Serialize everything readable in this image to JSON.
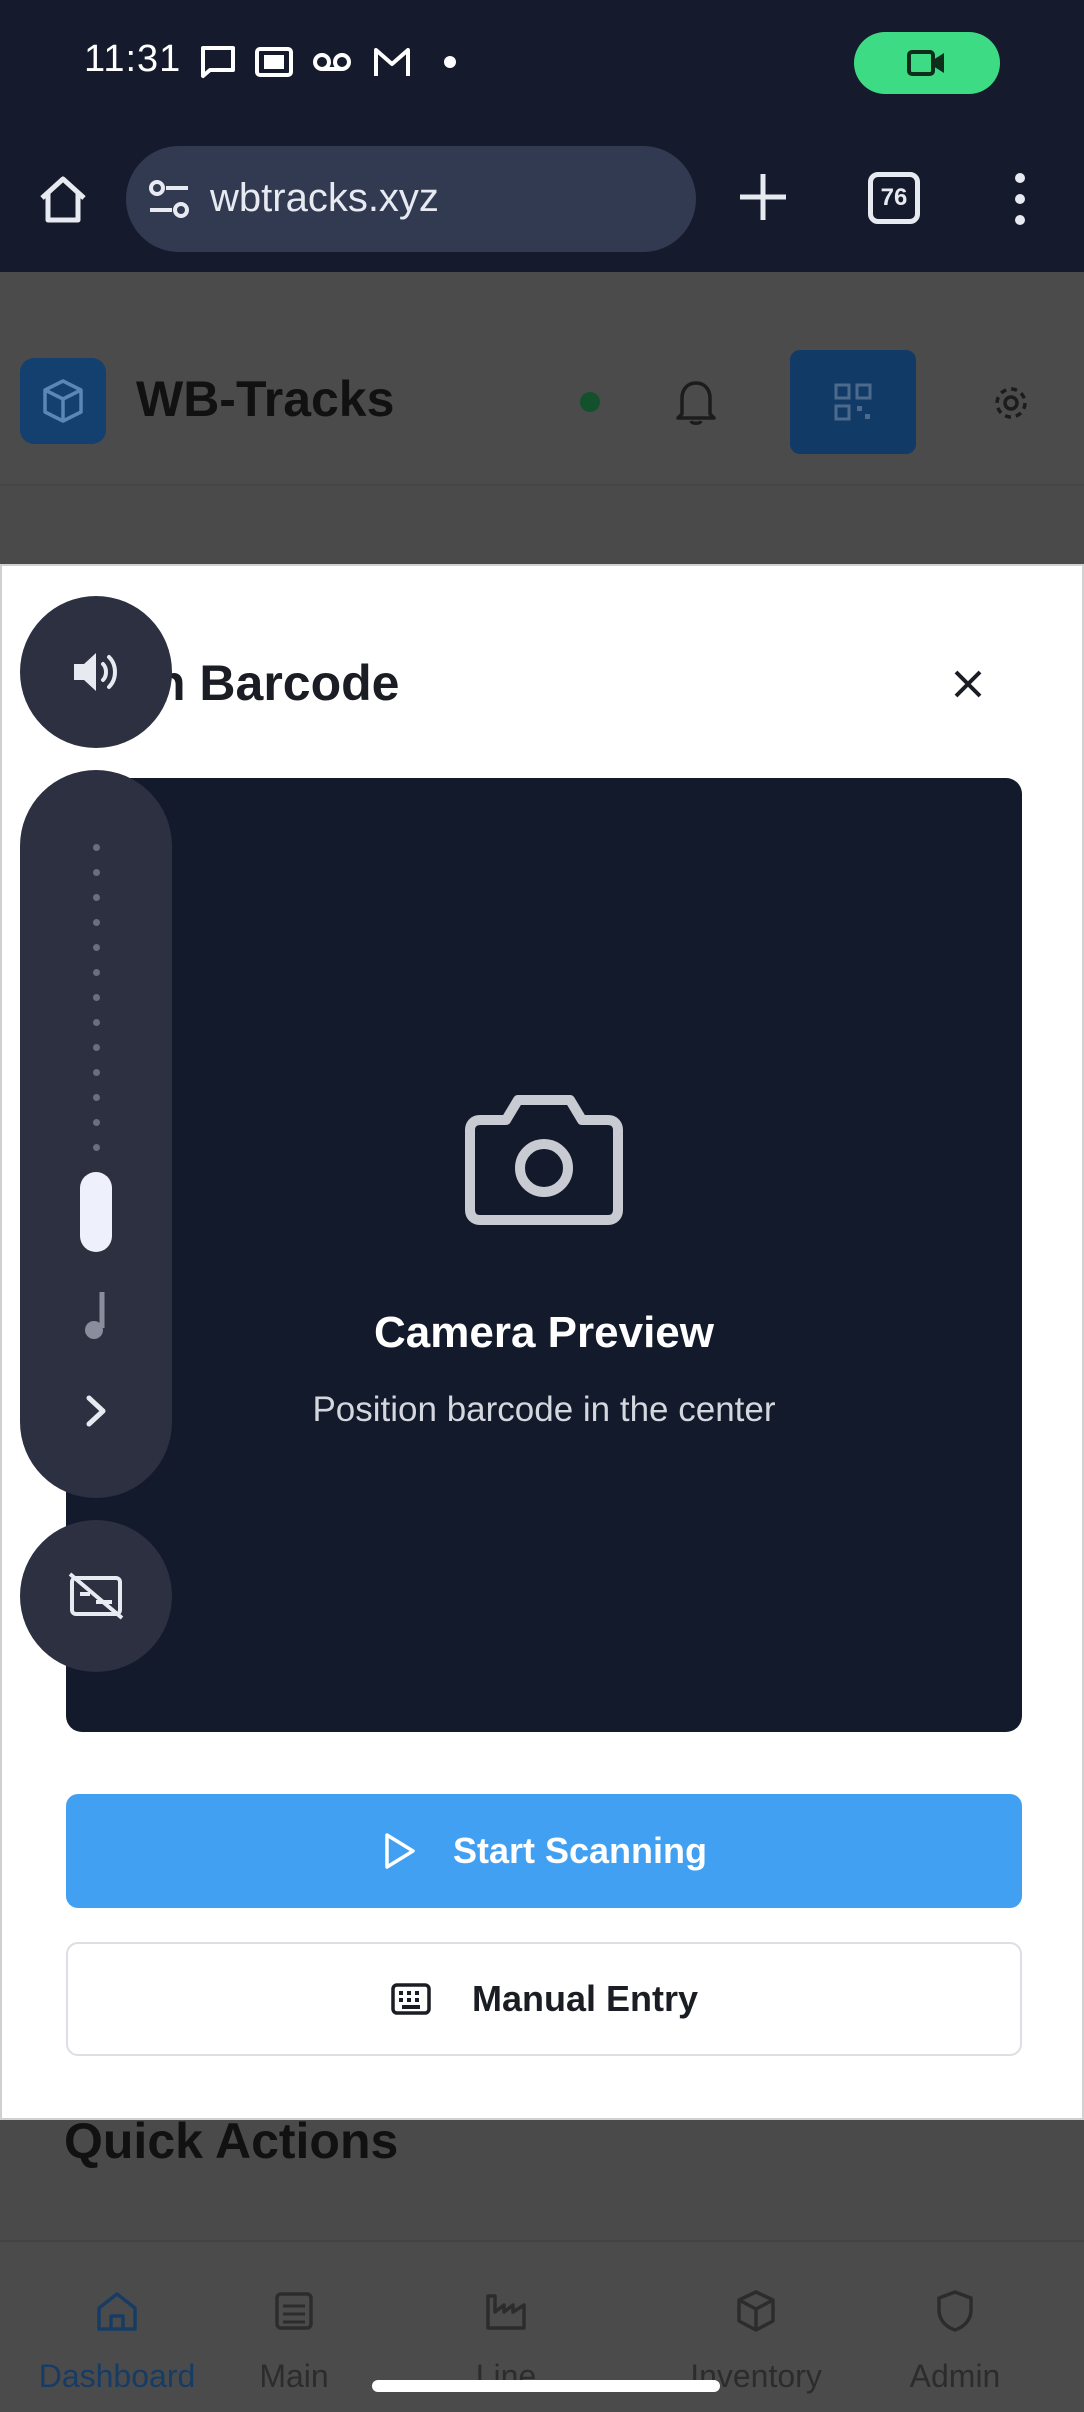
{
  "status_bar": {
    "time": "11:31",
    "icons": [
      "message-icon",
      "cast-icon",
      "voicemail-icon",
      "gmail-icon",
      "dot-icon"
    ],
    "recording_icon": "video-camera-icon",
    "recording_color": "#3ddc84"
  },
  "browser": {
    "url": "wbtracks.xyz",
    "tab_count": "76"
  },
  "app": {
    "title": "WB-Tracks",
    "online_color": "#1e8a4c",
    "accent": "#42a0f3"
  },
  "page": {
    "quick_actions_heading": "Quick Actions"
  },
  "modal": {
    "title": "Scan Barcode",
    "camera_title": "Camera Preview",
    "camera_subtitle": "Position barcode in the center",
    "start_label": "Start Scanning",
    "manual_label": "Manual Entry"
  },
  "volume_panel": {
    "icons": [
      "speaker-icon",
      "music-note-icon",
      "chevron-right-icon",
      "captions-off-icon"
    ],
    "level": 0.0
  },
  "bottom_nav": {
    "items": [
      {
        "label": "Dashboard",
        "icon": "home-icon",
        "active": true
      },
      {
        "label": "Main",
        "icon": "warehouse-icon"
      },
      {
        "label": "Line",
        "icon": "factory-icon"
      },
      {
        "label": "Inventory",
        "icon": "package-icon"
      },
      {
        "label": "Admin",
        "icon": "shield-icon"
      }
    ]
  }
}
